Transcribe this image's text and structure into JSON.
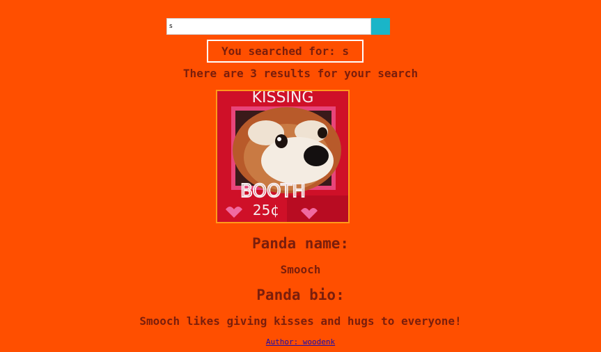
{
  "search": {
    "value": "s",
    "button_label": ""
  },
  "searched": {
    "text": "You searched for: s"
  },
  "results": {
    "text": "There are 3 results for your search"
  },
  "panda": {
    "image_sign_top": "KISSING",
    "image_sign_bottom": "BOOTH",
    "image_price": "25¢",
    "name_heading": "Panda name:",
    "name": "Smooch",
    "bio_heading": "Panda bio:",
    "bio": "Smooch likes giving kisses and hugs to everyone!",
    "author": "Author: woodenk"
  },
  "colors": {
    "background": "#ff4f00",
    "text": "#7a1e0c",
    "search_button": "#1ab5c8",
    "image_border": "#ff9a1a"
  }
}
